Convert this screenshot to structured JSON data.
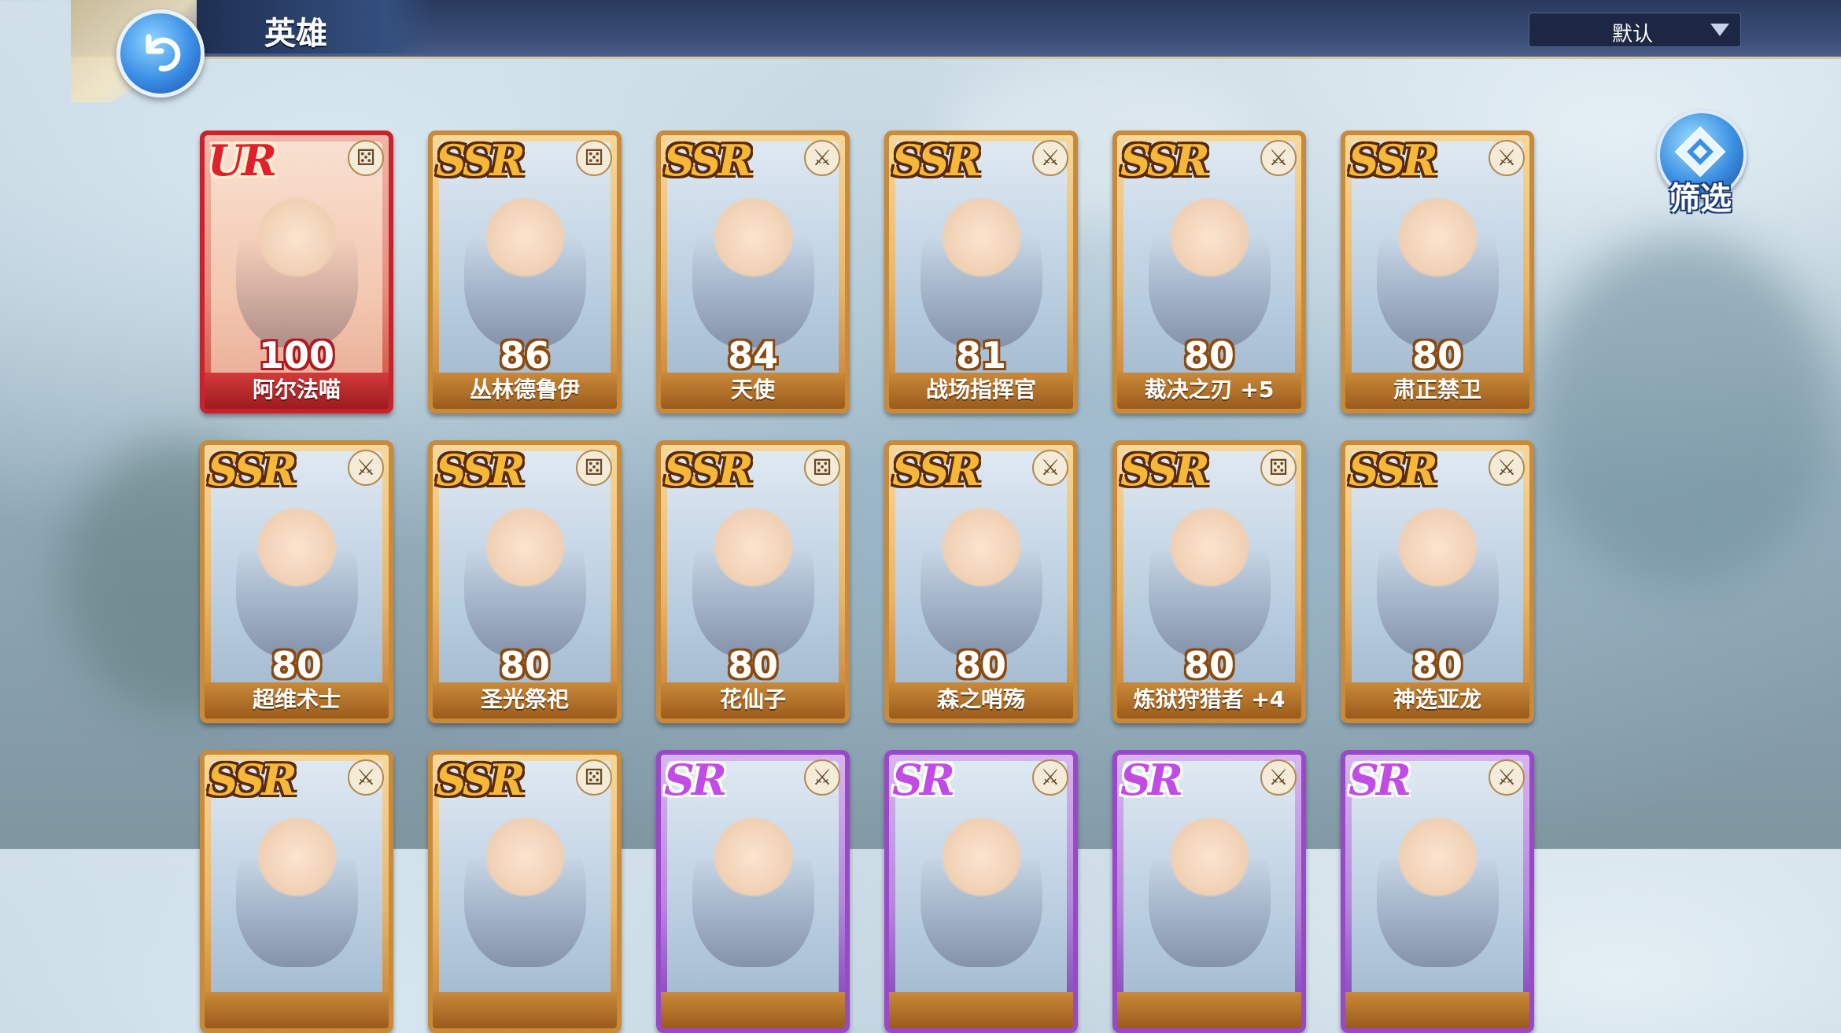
{
  "header": {
    "title": "英雄",
    "sort_value": "默认"
  },
  "filter": {
    "label": "筛选"
  },
  "heroes": [
    {
      "rarity": "UR",
      "level": "100",
      "name": "阿尔法喵",
      "class_icon": "staff-icon"
    },
    {
      "rarity": "SSR",
      "level": "86",
      "name": "丛林德鲁伊",
      "class_icon": "staff-icon"
    },
    {
      "rarity": "SSR",
      "level": "84",
      "name": "天使",
      "class_icon": "crossed-swords-icon"
    },
    {
      "rarity": "SSR",
      "level": "81",
      "name": "战场指挥官",
      "class_icon": "crossed-swords-icon"
    },
    {
      "rarity": "SSR",
      "level": "80",
      "name": "裁决之刃 +5",
      "class_icon": "crossed-swords-icon"
    },
    {
      "rarity": "SSR",
      "level": "80",
      "name": "肃正禁卫",
      "class_icon": "crossed-swords-icon"
    },
    {
      "rarity": "SSR",
      "level": "80",
      "name": "超维术士",
      "class_icon": "crossed-swords-icon"
    },
    {
      "rarity": "SSR",
      "level": "80",
      "name": "圣光祭祀",
      "class_icon": "staff-icon"
    },
    {
      "rarity": "SSR",
      "level": "80",
      "name": "花仙子",
      "class_icon": "staff-icon"
    },
    {
      "rarity": "SSR",
      "level": "80",
      "name": "森之哨殇",
      "class_icon": "crossed-swords-icon"
    },
    {
      "rarity": "SSR",
      "level": "80",
      "name": "炼狱狩猎者 +4",
      "class_icon": "staff-icon"
    },
    {
      "rarity": "SSR",
      "level": "80",
      "name": "神选亚龙",
      "class_icon": "crossed-swords-icon"
    },
    {
      "rarity": "SSR",
      "level": "",
      "name": "",
      "class_icon": "crossed-swords-icon"
    },
    {
      "rarity": "SSR",
      "level": "",
      "name": "",
      "class_icon": "staff-icon"
    },
    {
      "rarity": "SR",
      "level": "",
      "name": "",
      "class_icon": "crossed-swords-icon"
    },
    {
      "rarity": "SR",
      "level": "",
      "name": "",
      "class_icon": "crossed-swords-icon"
    },
    {
      "rarity": "SR",
      "level": "",
      "name": "",
      "class_icon": "crossed-swords-icon"
    },
    {
      "rarity": "SR",
      "level": "",
      "name": "",
      "class_icon": "crossed-swords-icon"
    }
  ]
}
